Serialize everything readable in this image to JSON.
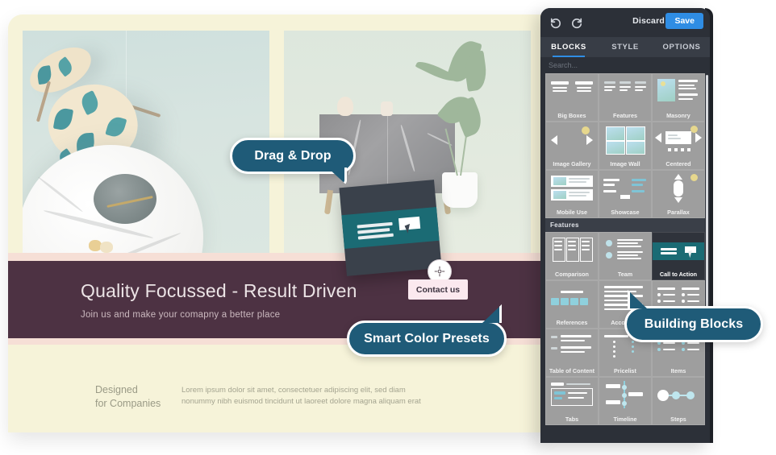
{
  "page": {
    "banner": {
      "heading": "Quality Focussed - Result Driven",
      "subheading": "Join us and make your comapny a better place"
    },
    "bottom": {
      "title_line1": "Designed",
      "title_line2": "for Companies",
      "body_line1": "Lorem ipsum dolor sit amet, consectetuer adipiscing elit, sed diam",
      "body_line2": "nonummy nibh euismod tincidunt ut laoreet dolore magna aliquam erat"
    }
  },
  "drag": {
    "contact_button": "Contact us"
  },
  "bubbles": [
    {
      "id": "drag-drop",
      "label": "Drag & Drop"
    },
    {
      "id": "smart-color-presets",
      "label": "Smart Color Presets"
    },
    {
      "id": "building-blocks",
      "label": "Building Blocks"
    }
  ],
  "panel": {
    "undo_label": "Undo",
    "redo_label": "Redo",
    "discard_label": "Discard",
    "save_label": "Save",
    "tabs": [
      {
        "label": "BLOCKS",
        "active": true
      },
      {
        "label": "STYLE",
        "active": false
      },
      {
        "label": "OPTIONS",
        "active": false
      }
    ],
    "search_placeholder": "Search...",
    "sections": [
      {
        "title": "",
        "blocks": [
          {
            "label": "Big Boxes",
            "selected": false
          },
          {
            "label": "Features",
            "selected": false
          },
          {
            "label": "Masonry",
            "selected": false
          },
          {
            "label": "Image Gallery",
            "selected": false
          },
          {
            "label": "Image Wall",
            "selected": false
          },
          {
            "label": "Centered",
            "selected": false
          },
          {
            "label": "Mobile Use",
            "selected": false
          },
          {
            "label": "Showcase",
            "selected": false
          },
          {
            "label": "Parallax",
            "selected": false
          }
        ]
      },
      {
        "title": "Features",
        "blocks": [
          {
            "label": "Comparison",
            "selected": false
          },
          {
            "label": "Team",
            "selected": false
          },
          {
            "label": "Call to Action",
            "selected": true
          },
          {
            "label": "References",
            "selected": false
          },
          {
            "label": "Accordion",
            "selected": false
          },
          {
            "label": "Items",
            "selected": false
          },
          {
            "label": "Table of Content",
            "selected": false
          },
          {
            "label": "Pricelist",
            "selected": false
          },
          {
            "label": "Items",
            "selected": false
          },
          {
            "label": "Tabs",
            "selected": false
          },
          {
            "label": "Timeline",
            "selected": false
          },
          {
            "label": "Steps",
            "selected": false
          }
        ]
      }
    ]
  },
  "colors": {
    "bubble": "#1f5b78",
    "save_button": "#2f8de4",
    "panel_bg": "#2c3038",
    "canvas_bg": "#f6f3d9",
    "banner_bg": "#4d3243",
    "band": "#f6dfd6",
    "contact_button_bg": "#fbe9ef",
    "block_teal": "#1b6b74"
  }
}
